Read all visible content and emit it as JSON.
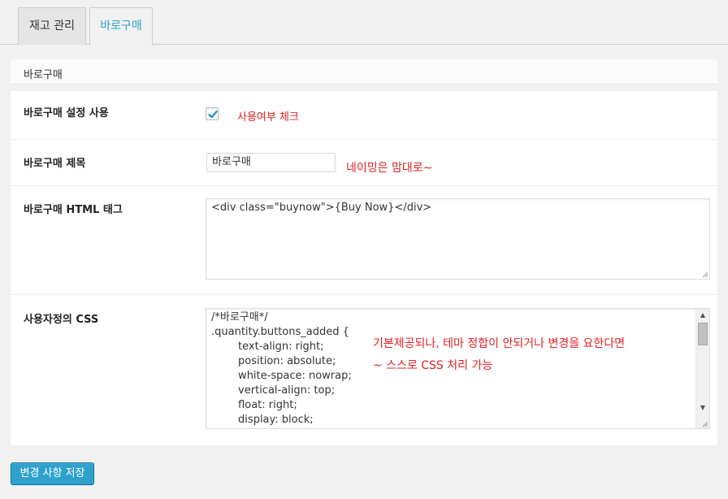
{
  "tabs": [
    {
      "label": "재고 관리",
      "active": false
    },
    {
      "label": "바로구매",
      "active": true
    }
  ],
  "section": {
    "title": "바로구매"
  },
  "fields": {
    "enable": {
      "label": "바로구매 설정 사용",
      "checked": true,
      "note": "사용여부 체크"
    },
    "title": {
      "label": "바로구매 제목",
      "value": "바로구매",
      "note": "네이밍은 맘대로~"
    },
    "html_tag": {
      "label": "바로구매 HTML 태그",
      "value": "<div class=\"buynow\">{Buy Now}</div>"
    },
    "custom_css": {
      "label": "사용자정의 CSS",
      "lines": [
        "/*바로구매*/",
        ".quantity.buttons_added {",
        "        text-align: right;",
        "        position: absolute;",
        "        white-space: nowrap;",
        "        vertical-align: top;",
        "        float: right;",
        "        display: block;"
      ],
      "note_line1": "기본제공되나, 테마 정합이 안되거나 변경을 요한다면",
      "note_line2": "~ 스스로 CSS 처리 가능"
    }
  },
  "save_button": {
    "label": "변경 사항 저장"
  },
  "colors": {
    "accent": "#2ea2cc",
    "note": "#e02020",
    "background": "#f1f1f1"
  }
}
